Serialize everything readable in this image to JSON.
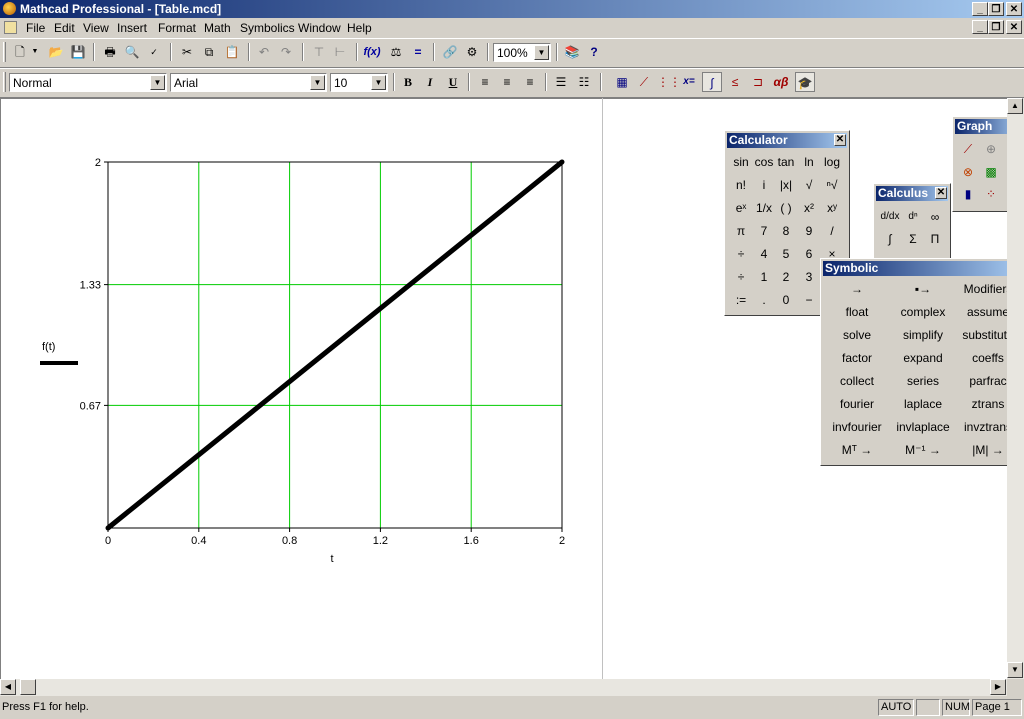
{
  "window": {
    "title": "Mathcad Professional - [Table.mcd]",
    "minimize": "_",
    "restore": "❐",
    "close": "✕"
  },
  "menu": [
    "File",
    "Edit",
    "View",
    "Insert",
    "Format",
    "Math",
    "Symbolics",
    "Window",
    "Help"
  ],
  "toolbar": {
    "zoom": "100%"
  },
  "format_bar": {
    "style": "Normal",
    "font": "Arial",
    "size": "10",
    "bold": "B",
    "italic": "I",
    "underline": "U"
  },
  "chart_data": {
    "type": "line",
    "x": [
      0,
      2
    ],
    "series": [
      {
        "name": "f(t)",
        "values": [
          0,
          2
        ]
      }
    ],
    "xlabel": "t",
    "ylabel": "f(t)",
    "xlim": [
      0,
      2
    ],
    "ylim": [
      0,
      2
    ],
    "x_ticks": [
      "0",
      "0.4",
      "0.8",
      "1.2",
      "1.6",
      "2"
    ],
    "y_ticks": [
      "0.67",
      "1.33",
      "2"
    ],
    "grid": true,
    "grid_color": "#00cc00",
    "line_color": "#000000"
  },
  "calculator": {
    "title": "Calculator",
    "keys": [
      [
        "sin",
        "cos",
        "tan",
        "ln",
        "log"
      ],
      [
        "n!",
        "i",
        "|x|",
        "√",
        "ⁿ√"
      ],
      [
        "eˣ",
        "1/x",
        "( )",
        "x²",
        "xʸ"
      ],
      [
        "π",
        "7",
        "8",
        "9",
        "/"
      ],
      [
        "÷",
        "4",
        "5",
        "6",
        "×"
      ],
      [
        "÷",
        "1",
        "2",
        "3",
        "+"
      ],
      [
        ":=",
        ".",
        "0",
        "−",
        "="
      ]
    ]
  },
  "calculus": {
    "title": "Calculus"
  },
  "graph": {
    "title": "Graph"
  },
  "symbolic": {
    "title": "Symbolic",
    "keys": [
      [
        "→",
        "▪→",
        "Modifiers"
      ],
      [
        "float",
        "complex",
        "assume"
      ],
      [
        "solve",
        "simplify",
        "substitute"
      ],
      [
        "factor",
        "expand",
        "coeffs"
      ],
      [
        "collect",
        "series",
        "parfrac"
      ],
      [
        "fourier",
        "laplace",
        "ztrans"
      ],
      [
        "invfourier",
        "invlaplace",
        "invztrans"
      ],
      [
        "Mᵀ →",
        "M⁻¹ →",
        "|M| →"
      ]
    ]
  },
  "status": {
    "help": "Press F1 for help.",
    "auto": "AUTO",
    "num": "NUM",
    "page": "Page 1"
  }
}
